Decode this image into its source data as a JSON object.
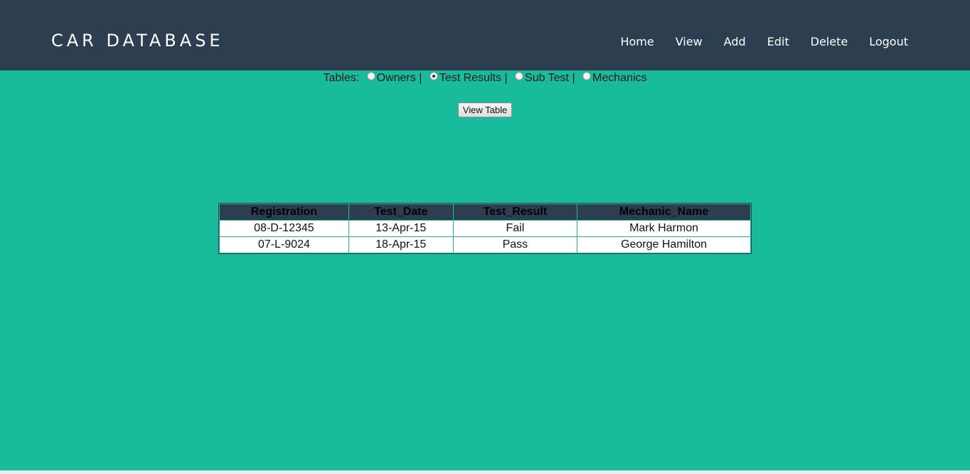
{
  "header": {
    "brand": "CAR DATABASE",
    "nav": [
      "Home",
      "View",
      "Add",
      "Edit",
      "Delete",
      "Logout"
    ]
  },
  "tables_selector": {
    "label": "Tables:",
    "options": [
      {
        "label": "Owners",
        "selected": false
      },
      {
        "label": "Test Results",
        "selected": true
      },
      {
        "label": "Sub Test",
        "selected": false
      },
      {
        "label": "Mechanics",
        "selected": false
      }
    ],
    "separator": "|"
  },
  "view_button": "View Table",
  "table": {
    "columns": [
      "Registration",
      "Test_Date",
      "Test_Result",
      "Mechanic_Name"
    ],
    "rows": [
      [
        "08-D-12345",
        "13-Apr-15",
        "Fail",
        "Mark Harmon"
      ],
      [
        "07-L-9024",
        "18-Apr-15",
        "Pass",
        "George Hamilton"
      ]
    ]
  },
  "colors": {
    "header_bg": "#2c3e50",
    "page_bg": "#18bc9c",
    "nav_text": "#ffffff"
  }
}
